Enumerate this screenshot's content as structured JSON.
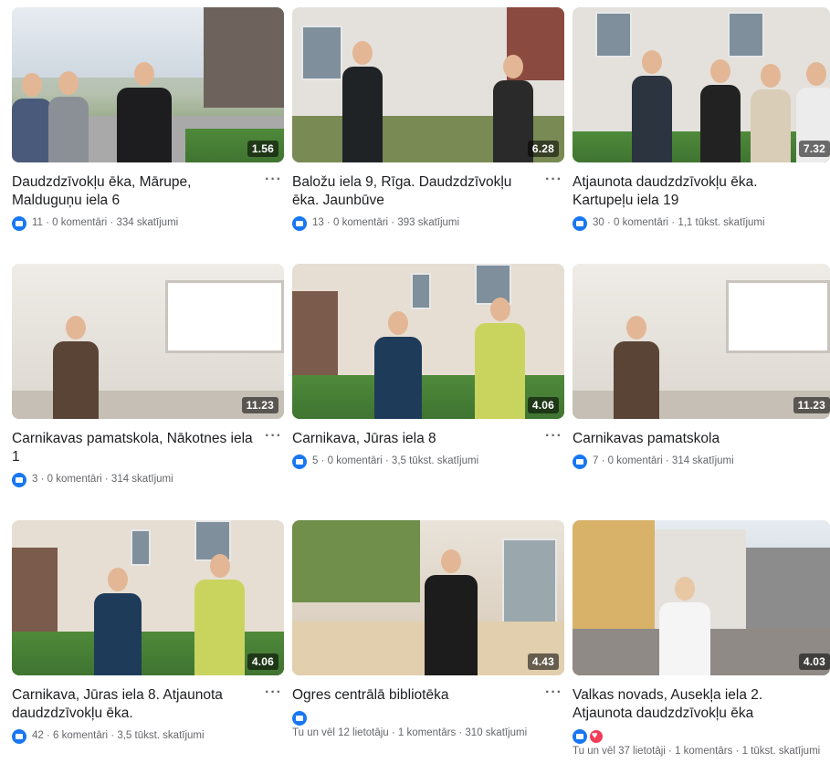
{
  "videos": [
    {
      "duration": "1.56",
      "title": "Daudzdzīvokļu ēka, Mārupe, Malduguņu iela 6",
      "stats": "11 · 0 komentāri · 334 skatījumi",
      "reactions": [
        "like"
      ]
    },
    {
      "duration": "6.28",
      "title": "Baložu iela 9, Rīga. Daudzdzīvokļu ēka. Jaunbūve",
      "stats": "13 · 0 komentāri · 393 skatījumi",
      "reactions": [
        "like"
      ]
    },
    {
      "duration": "7.32",
      "title": "Atjaunota daudzdzīvokļu ēka. Kartupeļu iela 19",
      "stats": "30 · 0 komentāri · 1,1 tūkst. skatījumi",
      "reactions": [
        "like"
      ]
    },
    {
      "duration": "11.23",
      "title": "Carnikavas pamatskola, Nākotnes iela 1",
      "stats": "3 · 0 komentāri · 314 skatījumi",
      "reactions": [
        "like"
      ]
    },
    {
      "duration": "4.06",
      "title": "Carnikava, Jūras iela 8",
      "stats": "5 · 0 komentāri · 3,5 tūkst. skatījumi",
      "reactions": [
        "like"
      ]
    },
    {
      "duration": "11.23",
      "title": "Carnikavas pamatskola",
      "stats": "7 · 0 komentāri · 314 skatījumi",
      "reactions": [
        "like"
      ]
    },
    {
      "duration": "4.06",
      "title": "Carnikava, Jūras iela 8. Atjaunota daudzdzīvokļu ēka.",
      "stats": "42 · 6 komentāri · 3,5 tūkst. skatījumi",
      "reactions": [
        "like"
      ]
    },
    {
      "duration": "4.43",
      "title": "Ogres centrālā bibliotēka",
      "stats": "Tu un vēl 12 lietotāju · 1 komentārs · 310 skatījumi",
      "reactions": [
        "like"
      ]
    },
    {
      "duration": "4.03",
      "title": "Valkas novads, Ausekļa iela 2. Atjaunota daudzdzīvokļu ēka",
      "stats": "Tu un vēl 37 lietotāji · 1 komentārs · 1 tūkst. skatījumi",
      "reactions": [
        "like",
        "love"
      ]
    }
  ],
  "more_label": "···",
  "colors": {
    "like": "#1877f2",
    "love": "#f33e58",
    "meta_text": "#65676b"
  }
}
